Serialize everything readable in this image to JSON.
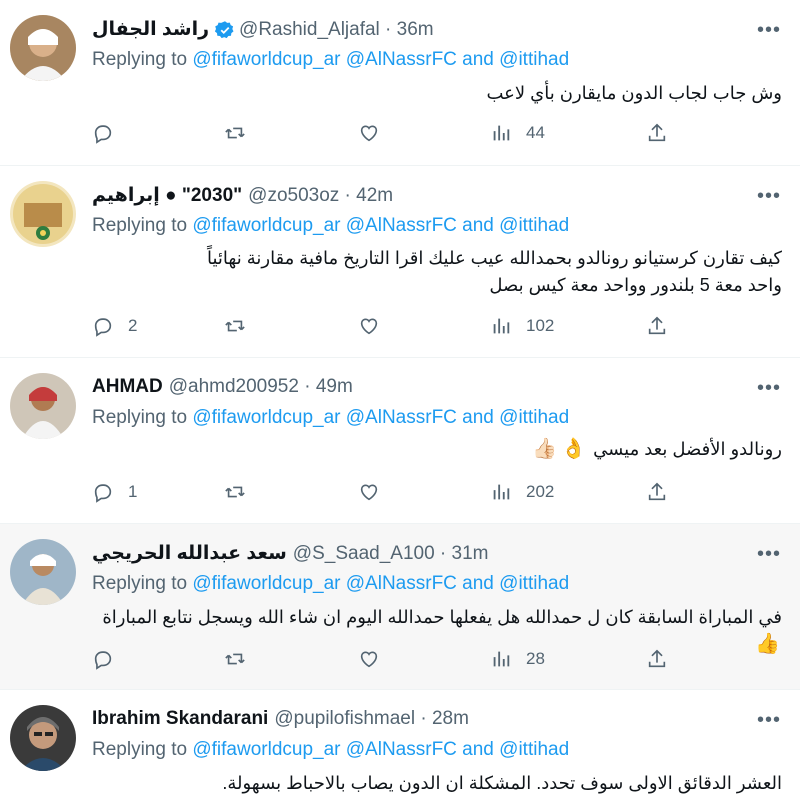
{
  "reply_label": "Replying to",
  "and_label": "and",
  "tweets": [
    {
      "name": "راشد الجفال",
      "handle": "@Rashid_Aljafal",
      "time": "36m",
      "mentions": [
        "@fifaworldcup_ar",
        "@AlNassrFC",
        "@ittihad"
      ],
      "body": [
        "وش جاب لجاب الدون مايقارن بأي لاعب"
      ],
      "replies": "",
      "views": "44"
    },
    {
      "name": "إبراهيم",
      "name_extra": "\"2030\"",
      "handle": "@zo503oz",
      "time": "42m",
      "mentions": [
        "@fifaworldcup_ar",
        "@AlNassrFC",
        "@ittihad"
      ],
      "body": [
        "كيف تقارن كرستيانو رونالدو بحمدالله عيب عليك اقرا التاريخ مافية مقارنة نهائياً",
        "واحد معة 5 بلندور وواحد معة كيس بصل"
      ],
      "replies": "2",
      "views": "102"
    },
    {
      "name": "AHMAD",
      "handle": "@ahmd200952",
      "time": "49m",
      "mentions": [
        "@fifaworldcup_ar",
        "@AlNassrFC",
        "@ittihad"
      ],
      "body": [
        "رونالدو الأفضل بعد ميسي"
      ],
      "replies": "1",
      "views": "202"
    },
    {
      "name": "سعد عبدالله الحريجي",
      "handle": "@S_Saad_A100",
      "time": "31m",
      "mentions": [
        "@fifaworldcup_ar",
        "@AlNassrFC",
        "@ittihad"
      ],
      "body": [
        "في المباراة السابقة كان ل حمدالله هل يفعلها حمدالله اليوم ان شاء الله ويسجل نتابع المباراة"
      ],
      "replies": "",
      "views": "28"
    },
    {
      "name": "Ibrahim Skandarani",
      "handle": "@pupilofishmael",
      "time": "28m",
      "mentions": [
        "@fifaworldcup_ar",
        "@AlNassrFC",
        "@ittihad"
      ],
      "body": [
        "العشر الدقائق الاولى سوف تحدد. المشكلة ان الدون يصاب بالاحباط بسهولة."
      ],
      "replies": "",
      "views": ""
    }
  ],
  "colors": {
    "link": "#1d9bf0",
    "muted": "#536471",
    "text": "#0f1419",
    "highlight_bg": "#f7f7f7"
  },
  "icons": [
    "reply-icon",
    "retweet-icon",
    "like-icon",
    "views-icon",
    "share-icon",
    "verified-icon",
    "more-icon"
  ]
}
